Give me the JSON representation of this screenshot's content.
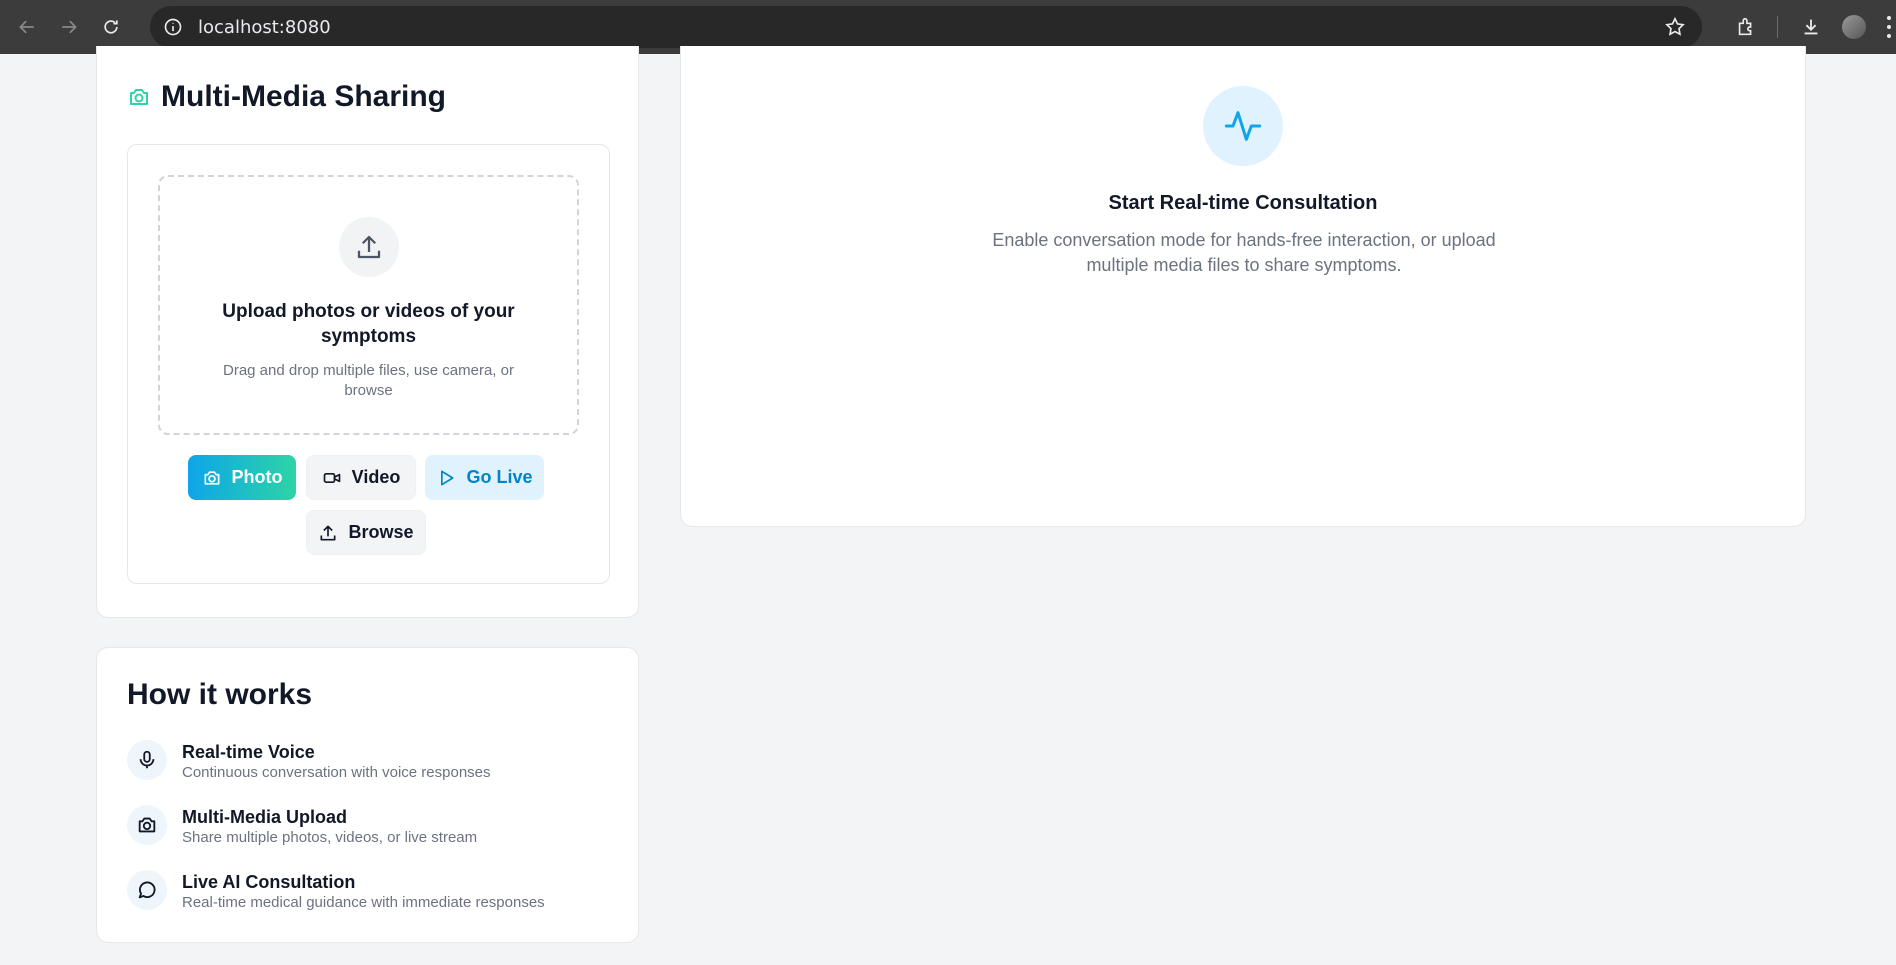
{
  "browser": {
    "url": "localhost:8080"
  },
  "media": {
    "title": "Multi-Media Sharing",
    "upload_title": "Upload photos or videos of your symptoms",
    "upload_subtitle": "Drag and drop multiple files, use camera, or browse",
    "buttons": {
      "photo": "Photo",
      "video": "Video",
      "go_live": "Go Live",
      "browse": "Browse"
    }
  },
  "how": {
    "title": "How it works",
    "items": [
      {
        "icon": "microphone-icon",
        "title": "Real-time Voice",
        "subtitle": "Continuous conversation with voice responses"
      },
      {
        "icon": "camera-icon",
        "title": "Multi-Media Upload",
        "subtitle": "Share multiple photos, videos, or live stream"
      },
      {
        "icon": "chat-bubble-icon",
        "title": "Live AI Consultation",
        "subtitle": "Real-time medical guidance with immediate responses"
      }
    ]
  },
  "consultation": {
    "title": "Start Real-time Consultation",
    "subtitle": "Enable conversation mode for hands-free interaction, or upload multiple media files to share symptoms."
  },
  "colors": {
    "accent_blue": "#0ea5e9",
    "accent_green": "#2dd4a7",
    "live_text": "#0284c7"
  }
}
